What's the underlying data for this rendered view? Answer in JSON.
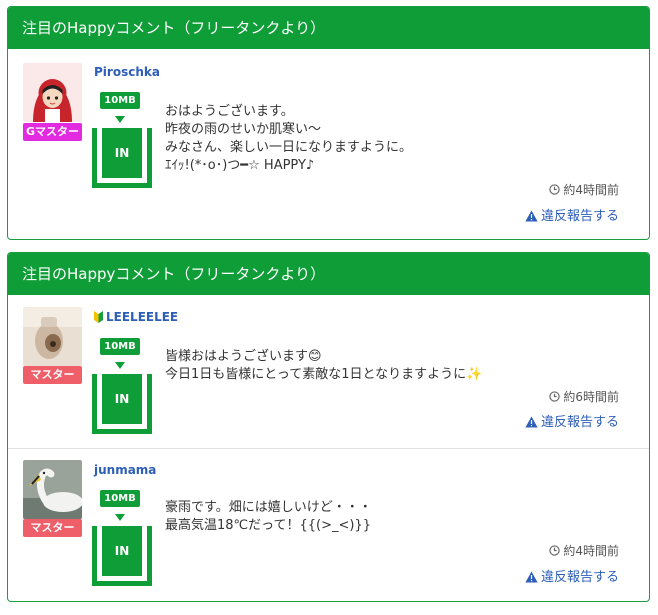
{
  "cards": [
    {
      "header": "注目のHappyコメント（フリータンクより）",
      "entries": [
        {
          "username": "Piroschka",
          "role": "Gマスター",
          "tank_badge": "10MB",
          "tank_label": "IN",
          "message": "おはようございます。\n昨夜の雨のせいか肌寒い〜\nみなさん、楽しい一日になりますように。\nｴｲｯ!(*･o･)つ━☆ HAPPY♪",
          "time": "約4時間前",
          "report": "違反報告する"
        }
      ]
    },
    {
      "header": "注目のHappyコメント（フリータンクより）",
      "entries": [
        {
          "username": "LEELEELEE",
          "role": "マスター",
          "tank_badge": "10MB",
          "tank_label": "IN",
          "message": "皆様おはようございます😊\n今日1日も皆様にとって素敵な1日となりますように✨",
          "time": "約6時間前",
          "report": "違反報告する"
        },
        {
          "username": "junmama",
          "role": "マスター",
          "tank_badge": "10MB",
          "tank_label": "IN",
          "message": "豪雨です。畑には嬉しいけど・・・\n最高気温18℃だって！{{(>_<)}}",
          "time": "約4時間前",
          "report": "違反報告する"
        }
      ]
    }
  ],
  "colors": {
    "header_green": "#0f9d38",
    "link_blue": "#2d5eb8",
    "role_pink": "#e22be0",
    "role_red": "#ee5f6a"
  }
}
